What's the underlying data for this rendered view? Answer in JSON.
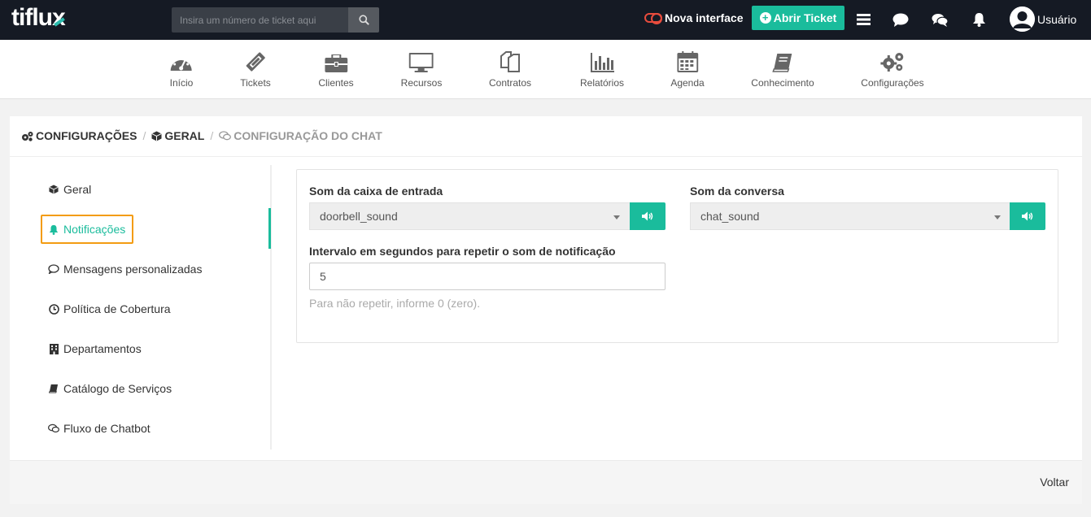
{
  "header": {
    "logo_a": "tiflu",
    "logo_b": "x",
    "search_placeholder": "Insira um número de ticket aqui",
    "nova_interface": "Nova interface",
    "abrir_ticket": "Abrir Ticket",
    "user_label": "Usuário"
  },
  "nav": {
    "items": [
      {
        "label": "Início"
      },
      {
        "label": "Tickets"
      },
      {
        "label": "Clientes"
      },
      {
        "label": "Recursos"
      },
      {
        "label": "Contratos"
      },
      {
        "label": "Relatórios"
      },
      {
        "label": "Agenda"
      },
      {
        "label": "Conhecimento"
      },
      {
        "label": "Configurações"
      }
    ]
  },
  "breadcrumb": {
    "level1": "Configurações",
    "level2": "Geral",
    "level3": "Configuração do chat"
  },
  "sidebar": {
    "items": [
      {
        "label": "Geral"
      },
      {
        "label": "Notificações"
      },
      {
        "label": "Mensagens personalizadas"
      },
      {
        "label": "Política de Cobertura"
      },
      {
        "label": "Departamentos"
      },
      {
        "label": "Catálogo de Serviços"
      },
      {
        "label": "Fluxo de Chatbot"
      }
    ]
  },
  "form": {
    "inbox_sound_label": "Som da caixa de entrada",
    "inbox_sound_value": "doorbell_sound",
    "chat_sound_label": "Som da conversa",
    "chat_sound_value": "chat_sound",
    "interval_label": "Intervalo em segundos para repetir o som de notificação",
    "interval_value": "5",
    "interval_help": "Para não repetir, informe 0 (zero)."
  },
  "footer": {
    "back_label": "Voltar"
  },
  "colors": {
    "accent": "#1abc9c",
    "topbar": "#151a24",
    "highlight": "#f39c12",
    "toggle": "#e84c3d"
  }
}
